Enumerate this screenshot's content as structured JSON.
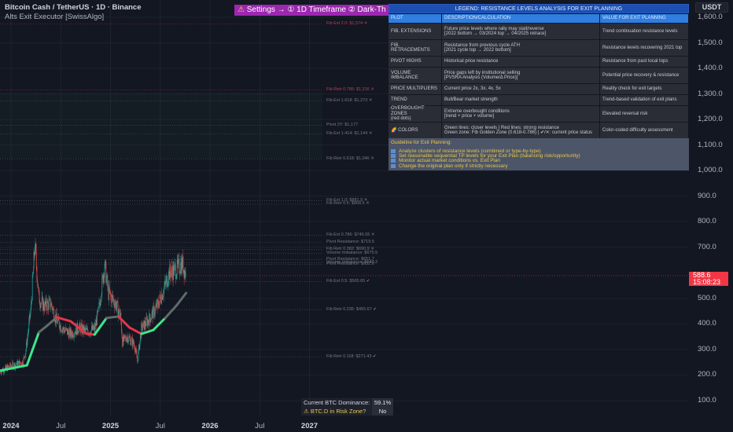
{
  "header": {
    "symbol": "Bitcoin Cash / TetherUS · 1D · Binance",
    "indicator": "Alts Exit Executor [SwissAlgo]"
  },
  "banner": {
    "warn_icon": "⚠",
    "text": " Settings → ① 1D Timeframe ② Dark-Th"
  },
  "legend": {
    "title": "LEGEND: RESISTANCE LEVELS ANALYSIS FOR EXIT PLANNING",
    "headers": [
      "PLOT",
      "DESCRIPTION/CALCULATION",
      "VALUE FOR EXIT PLANNING"
    ],
    "rows": [
      {
        "plot": "FIB. EXTENSIONS",
        "desc": "Future price levels where rally may stall/reverse",
        "desc2": "[2022 bottom → 03/2024 top → 04/2025 retrace]",
        "value": "Trend continuation resistance levels"
      },
      {
        "plot": "FIB. RETRACEMENTS",
        "desc": "Resistance from previous cycle ATH",
        "desc2": "[2021 cycle top → 2022 bottom]",
        "value": "Resistance levels recovering 2021 top"
      },
      {
        "plot": "PIVOT HIGHS",
        "desc": "Historical price resistance",
        "desc2": "",
        "value": "Resistance from past local tops"
      },
      {
        "plot": "VOLUME IMBALANCE",
        "desc": "Price gaps left by institutional selling",
        "desc2": "[PVSRA Analysis (Volume/Δ Price)]",
        "value": "Potential price recovery & resistance"
      },
      {
        "plot": "PRICE MULTIPLIERS",
        "desc": "Current price 2x, 3x, 4x, 5x",
        "desc2": "",
        "value": "Reality check for exit targets"
      },
      {
        "plot": "TREND",
        "desc": "Bull/Bear market strength",
        "desc2": "",
        "value": "Trend-based validation of exit plans"
      },
      {
        "plot": "OVERBOUGHT ZONES",
        "plot2": "(red dots)",
        "desc": "Extreme overbought conditions",
        "desc2": "[trend + price + volume]",
        "value": "Elevated reversal risk"
      },
      {
        "plot": "🌈 COLORS",
        "desc": "Green lines: closer levels | Red lines: strong resistance",
        "desc2": "Green zone: Fib Golden Zone (0.618-0.786) | ✔/✕: current price status",
        "value": "Color-coded difficulty assessment"
      }
    ],
    "guide_title": "Guideline for Exit Planning:",
    "guide_items": [
      "Analyze clusters of resistance levels (combined or type-by-type)",
      "Set reasonable sequential TP levels for your Exit Plan (balancing risk/opportunity)",
      "Monitor actual market conditions vs. Exit Plan",
      "Change the original plan only if strictly necessary"
    ]
  },
  "axis": {
    "currency": "USDT",
    "ticks": [
      "1,600.0",
      "1,500.0",
      "1,400.0",
      "1,300.0",
      "1,200.0",
      "1,100.0",
      "1,000.0",
      "900.0",
      "800.0",
      "700.0",
      "500.0",
      "400.0",
      "300.0",
      "200.0",
      "100.0"
    ],
    "tick_values": [
      1600,
      1500,
      1400,
      1300,
      1200,
      1100,
      1000,
      900,
      800,
      700,
      500,
      400,
      300,
      200,
      100
    ],
    "current_price": "588.6",
    "countdown": "15:08:23",
    "current_value": 588.6
  },
  "time_axis": [
    {
      "label": "2024",
      "year": 2024,
      "bold": true
    },
    {
      "label": "Jul",
      "year": 2024.5
    },
    {
      "label": "2025",
      "year": 2025,
      "bold": true
    },
    {
      "label": "Jul",
      "year": 2025.5
    },
    {
      "label": "2026",
      "year": 2026,
      "bold": true
    },
    {
      "label": "Jul",
      "year": 2026.5
    },
    {
      "label": "2027",
      "year": 2027,
      "bold": true
    }
  ],
  "levels": [
    {
      "label": "Fib Ext 2.0: $1,574 ✕",
      "price": 1574,
      "red": true
    },
    {
      "label": "Fib Retr 0.786: $1,316 ✕",
      "price": 1316,
      "red": true
    },
    {
      "label": "Fib Ext 1.618: $1,273 ✕",
      "price": 1273
    },
    {
      "label": "Pivot 2Y: $1,177",
      "price": 1177
    },
    {
      "label": "Fib Ext 1.414: $1,144 ✕",
      "price": 1144
    },
    {
      "label": "Fib Retr 0.618: $1,046 ✕",
      "price": 1046
    },
    {
      "label": "Fib Ext 1.0: $881.9 ✕",
      "price": 881.9
    },
    {
      "label": "Fib Retr 0.5: $868.5 ✕",
      "price": 868.5
    },
    {
      "label": "Fib Ext 0.786: $746.55 ✕",
      "price": 746.55
    },
    {
      "label": "Pivot Resistance: $719.5",
      "price": 719.5
    },
    {
      "label": "Fib Retr 0.382: $690.9 ✕",
      "price": 690.9
    },
    {
      "label": "Volume Imbalance: $675.5",
      "price": 675.5
    },
    {
      "label": "Pivot Resistance: $651.7",
      "price": 651.7
    },
    {
      "label": "Volume Imbalance: $640.2",
      "price": 640.2
    },
    {
      "label": "Pivot Resistance: $632.8",
      "price": 632.8
    },
    {
      "label": "Fib Ext 0.5: $565.65 ✔",
      "price": 565.65
    },
    {
      "label": "Fib Retr 0.236: $455.67 ✔",
      "price": 455.67
    },
    {
      "label": "Fib Retr 0.118: $271.43 ✔",
      "price": 271.43
    }
  ],
  "price_path": [
    [
      2023.89,
      215
    ],
    [
      2024.0,
      235
    ],
    [
      2024.12,
      250
    ],
    [
      2024.15,
      300
    ],
    [
      2024.2,
      460
    ],
    [
      2024.24,
      708
    ],
    [
      2024.28,
      500
    ],
    [
      2024.33,
      470
    ],
    [
      2024.4,
      480
    ],
    [
      2024.45,
      420
    ],
    [
      2024.52,
      380
    ],
    [
      2024.6,
      360
    ],
    [
      2024.68,
      385
    ],
    [
      2024.76,
      370
    ],
    [
      2024.84,
      380
    ],
    [
      2024.88,
      450
    ],
    [
      2024.94,
      632
    ],
    [
      2024.98,
      520
    ],
    [
      2025.05,
      480
    ],
    [
      2025.1,
      430
    ],
    [
      2025.12,
      330
    ],
    [
      2025.17,
      350
    ],
    [
      2025.24,
      320
    ],
    [
      2025.27,
      254
    ],
    [
      2025.31,
      380
    ],
    [
      2025.39,
      420
    ],
    [
      2025.47,
      470
    ],
    [
      2025.55,
      550
    ],
    [
      2025.59,
      600
    ],
    [
      2025.67,
      615
    ],
    [
      2025.72,
      638
    ],
    [
      2025.76,
      589
    ]
  ],
  "trend_path": [
    [
      2023.89,
      217,
      "g"
    ],
    [
      2024.16,
      238,
      "g"
    ],
    [
      2024.28,
      367,
      "n"
    ],
    [
      2024.36,
      392,
      "n"
    ],
    [
      2024.46,
      426,
      "r"
    ],
    [
      2024.6,
      410,
      "r"
    ],
    [
      2024.76,
      361,
      "r"
    ],
    [
      2024.84,
      358,
      "g"
    ],
    [
      2024.96,
      423,
      "n"
    ],
    [
      2025.08,
      429,
      "r"
    ],
    [
      2025.19,
      386,
      "r"
    ],
    [
      2025.31,
      361,
      "g"
    ],
    [
      2025.43,
      376,
      "g"
    ],
    [
      2025.55,
      423,
      "n"
    ],
    [
      2025.67,
      475,
      "n"
    ],
    [
      2025.76,
      521,
      "n"
    ]
  ],
  "colors": {
    "bull": "#3ee58a",
    "bear": "#e8344a",
    "neutral": "#5f6b66",
    "up": "#26a69a",
    "down": "#ef5350"
  },
  "dominance": {
    "label": "Current BTC Dominance:",
    "value": "59.1%",
    "risk_label": "BTC.D in Risk Zone?",
    "risk_value": "No",
    "warn_icon": "⚠"
  }
}
